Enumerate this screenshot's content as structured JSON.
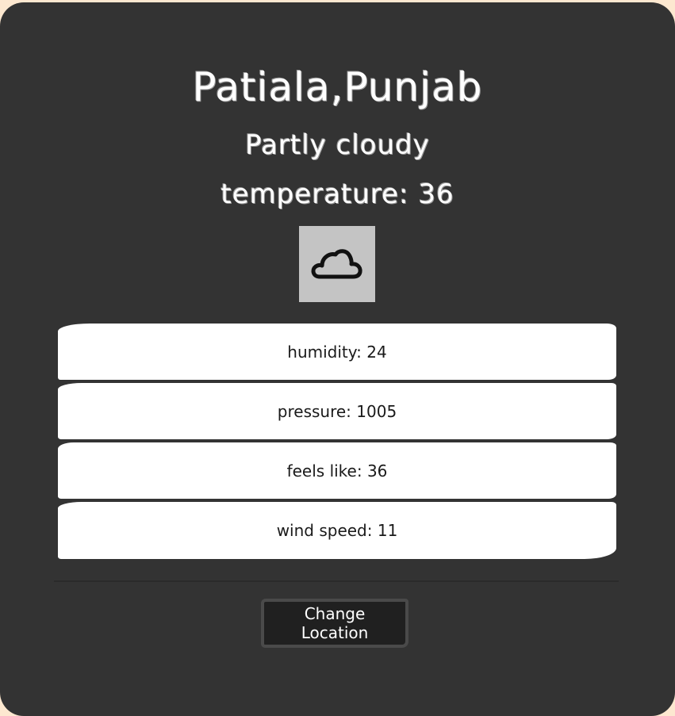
{
  "location": {
    "city": "Patiala",
    "separator": ",",
    "region": "Punjab"
  },
  "weather": {
    "condition": "Partly cloudy",
    "temperature_label": "temperature:",
    "temperature_value": "36",
    "icon": "cloud-icon"
  },
  "stats": [
    {
      "label": "humidity:",
      "value": "24"
    },
    {
      "label": "pressure:",
      "value": "1005"
    },
    {
      "label": "feels like:",
      "value": "36"
    },
    {
      "label": "wind speed:",
      "value": "11"
    }
  ],
  "actions": {
    "change_location_label": "Change Location"
  },
  "colors": {
    "background": "#fde8d0",
    "card": "#333333",
    "stat_card": "#ffffff",
    "button": "#202020",
    "icon_bg": "#c4c4c4"
  }
}
